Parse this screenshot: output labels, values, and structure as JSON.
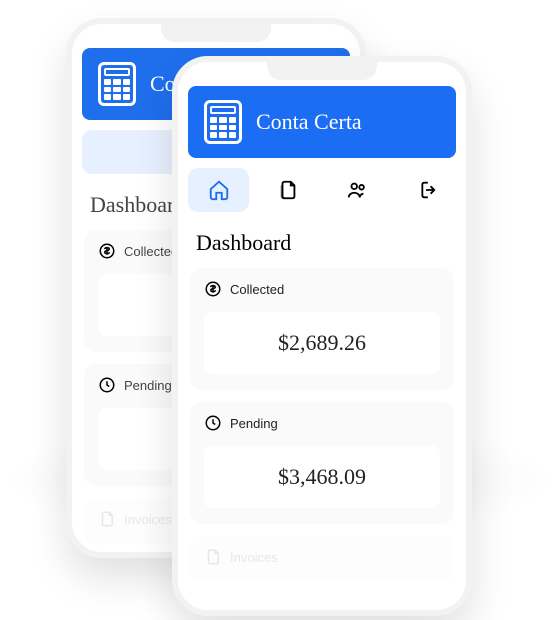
{
  "app": {
    "title": "Conta Certa"
  },
  "nav": {
    "home": "Home",
    "documents": "Documents",
    "clients": "Clients",
    "logout": "Logout"
  },
  "dashboard": {
    "title": "Dashboard",
    "collected": {
      "label": "Collected",
      "value": "$2,689.26"
    },
    "pending": {
      "label": "Pending",
      "value": "$3,468.09"
    },
    "invoices": {
      "label": "Invoices"
    }
  },
  "colors": {
    "primary": "#1b6ef3"
  }
}
